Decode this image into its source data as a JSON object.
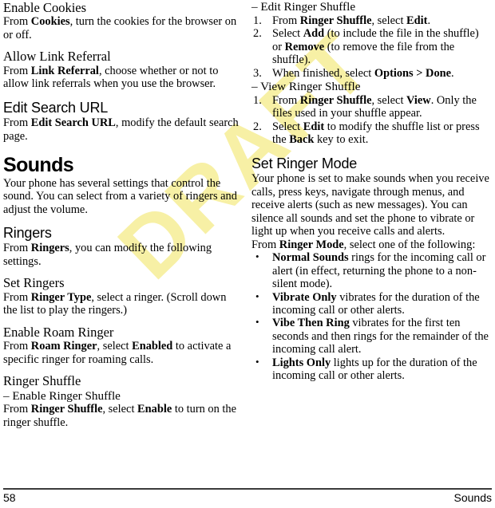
{
  "watermark": {
    "text": "DRAFT",
    "color": "#f7f0a5"
  },
  "footer": {
    "page_number": "58",
    "section": "Sounds"
  },
  "left_column": {
    "enable_cookies": {
      "heading": "Enable Cookies",
      "body_pre": "From ",
      "body_bold": "Cookies",
      "body_post": ", turn the cookies for the browser on or off."
    },
    "allow_link_referral": {
      "heading": "Allow Link Referral",
      "body_pre": "From ",
      "body_bold": "Link Referral",
      "body_post": ", choose whether or not to allow link referrals when you use the browser."
    },
    "edit_search_url": {
      "heading": "Edit Search URL",
      "body_pre": "From ",
      "body_bold": "Edit Search URL",
      "body_post": ", modify the default search page."
    },
    "sounds": {
      "heading": "Sounds",
      "body": "Your phone has several settings that control the sound. You can select from a variety of ringers and adjust the volume."
    },
    "ringers": {
      "heading": "Ringers",
      "body_pre": "From ",
      "body_bold": "Ringers",
      "body_post": ", you can modify the following settings."
    },
    "set_ringers": {
      "heading": "Set Ringers",
      "body_pre": "From ",
      "body_bold": "Ringer Type",
      "body_post": ", select a ringer. (Scroll down the list to play the ringers.)"
    },
    "enable_roam_ringer": {
      "heading": "Enable Roam Ringer",
      "body_pre": "From ",
      "body_bold1": "Roam Ringer",
      "body_mid": ", select ",
      "body_bold2": "Enabled",
      "body_post": " to activate a specific ringer for roaming calls."
    },
    "ringer_shuffle": {
      "heading": "Ringer Shuffle",
      "enable_sub": {
        "dash_heading": "– Enable Ringer Shuffle",
        "body_pre": "From ",
        "body_bold1": "Ringer Shuffle",
        "body_mid": ", select ",
        "body_bold2": "Enable",
        "body_post": " to turn on the ringer shuffle."
      }
    }
  },
  "right_column": {
    "edit_ringer_shuffle": {
      "dash_heading": "– Edit Ringer Shuffle",
      "steps": [
        {
          "marker": "1.",
          "pre": "From ",
          "bold1": "Ringer Shuffle",
          "mid": ", select ",
          "bold2": "Edit",
          "post": "."
        },
        {
          "marker": "2.",
          "pre": "Select ",
          "bold1": "Add",
          "mid": " (to include the file in the shuffle) or ",
          "bold2": "Remove",
          "post": " (to remove the file from the shuffle)."
        },
        {
          "marker": "3.",
          "pre": "When finished, select ",
          "bold1": "Options > Done",
          "mid": "",
          "bold2": "",
          "post": "."
        }
      ]
    },
    "view_ringer_shuffle": {
      "dash_heading": "–  View Ringer Shuffle",
      "steps": [
        {
          "marker": "1.",
          "pre": "From ",
          "bold1": "Ringer Shuffle",
          "mid": ", select ",
          "bold2": "View",
          "post": ". Only the files used in your shuffle appear."
        },
        {
          "marker": "2.",
          "pre": "Select ",
          "bold1": "Edit",
          "mid": " to modify the shuffle list or press the ",
          "bold2": "Back",
          "post": " key to exit."
        }
      ]
    },
    "set_ringer_mode": {
      "heading": "Set Ringer Mode",
      "intro": "Your phone is set to make sounds when you receive calls, press keys, navigate through menus, and receive alerts (such as new messages). You can silence all sounds and set the phone to vibrate or light up when you receive calls and alerts.",
      "lead_pre": "From ",
      "lead_bold": "Ringer Mode",
      "lead_post": ", select one of the following:",
      "options": [
        {
          "marker": "•",
          "bold": "Normal Sounds",
          "text": " rings for the incoming call or alert (in effect, returning the phone to a non-silent mode)."
        },
        {
          "marker": "•",
          "bold": "Vibrate Only",
          "text": " vibrates for the duration of the incoming call or other alerts."
        },
        {
          "marker": "•",
          "bold": "Vibe Then Ring",
          "text": " vibrates for the first ten seconds and then rings for the remainder of the incoming call alert."
        },
        {
          "marker": "•",
          "bold": "Lights Only",
          "text": " lights up for the duration of the incoming call or other alerts."
        }
      ]
    }
  }
}
